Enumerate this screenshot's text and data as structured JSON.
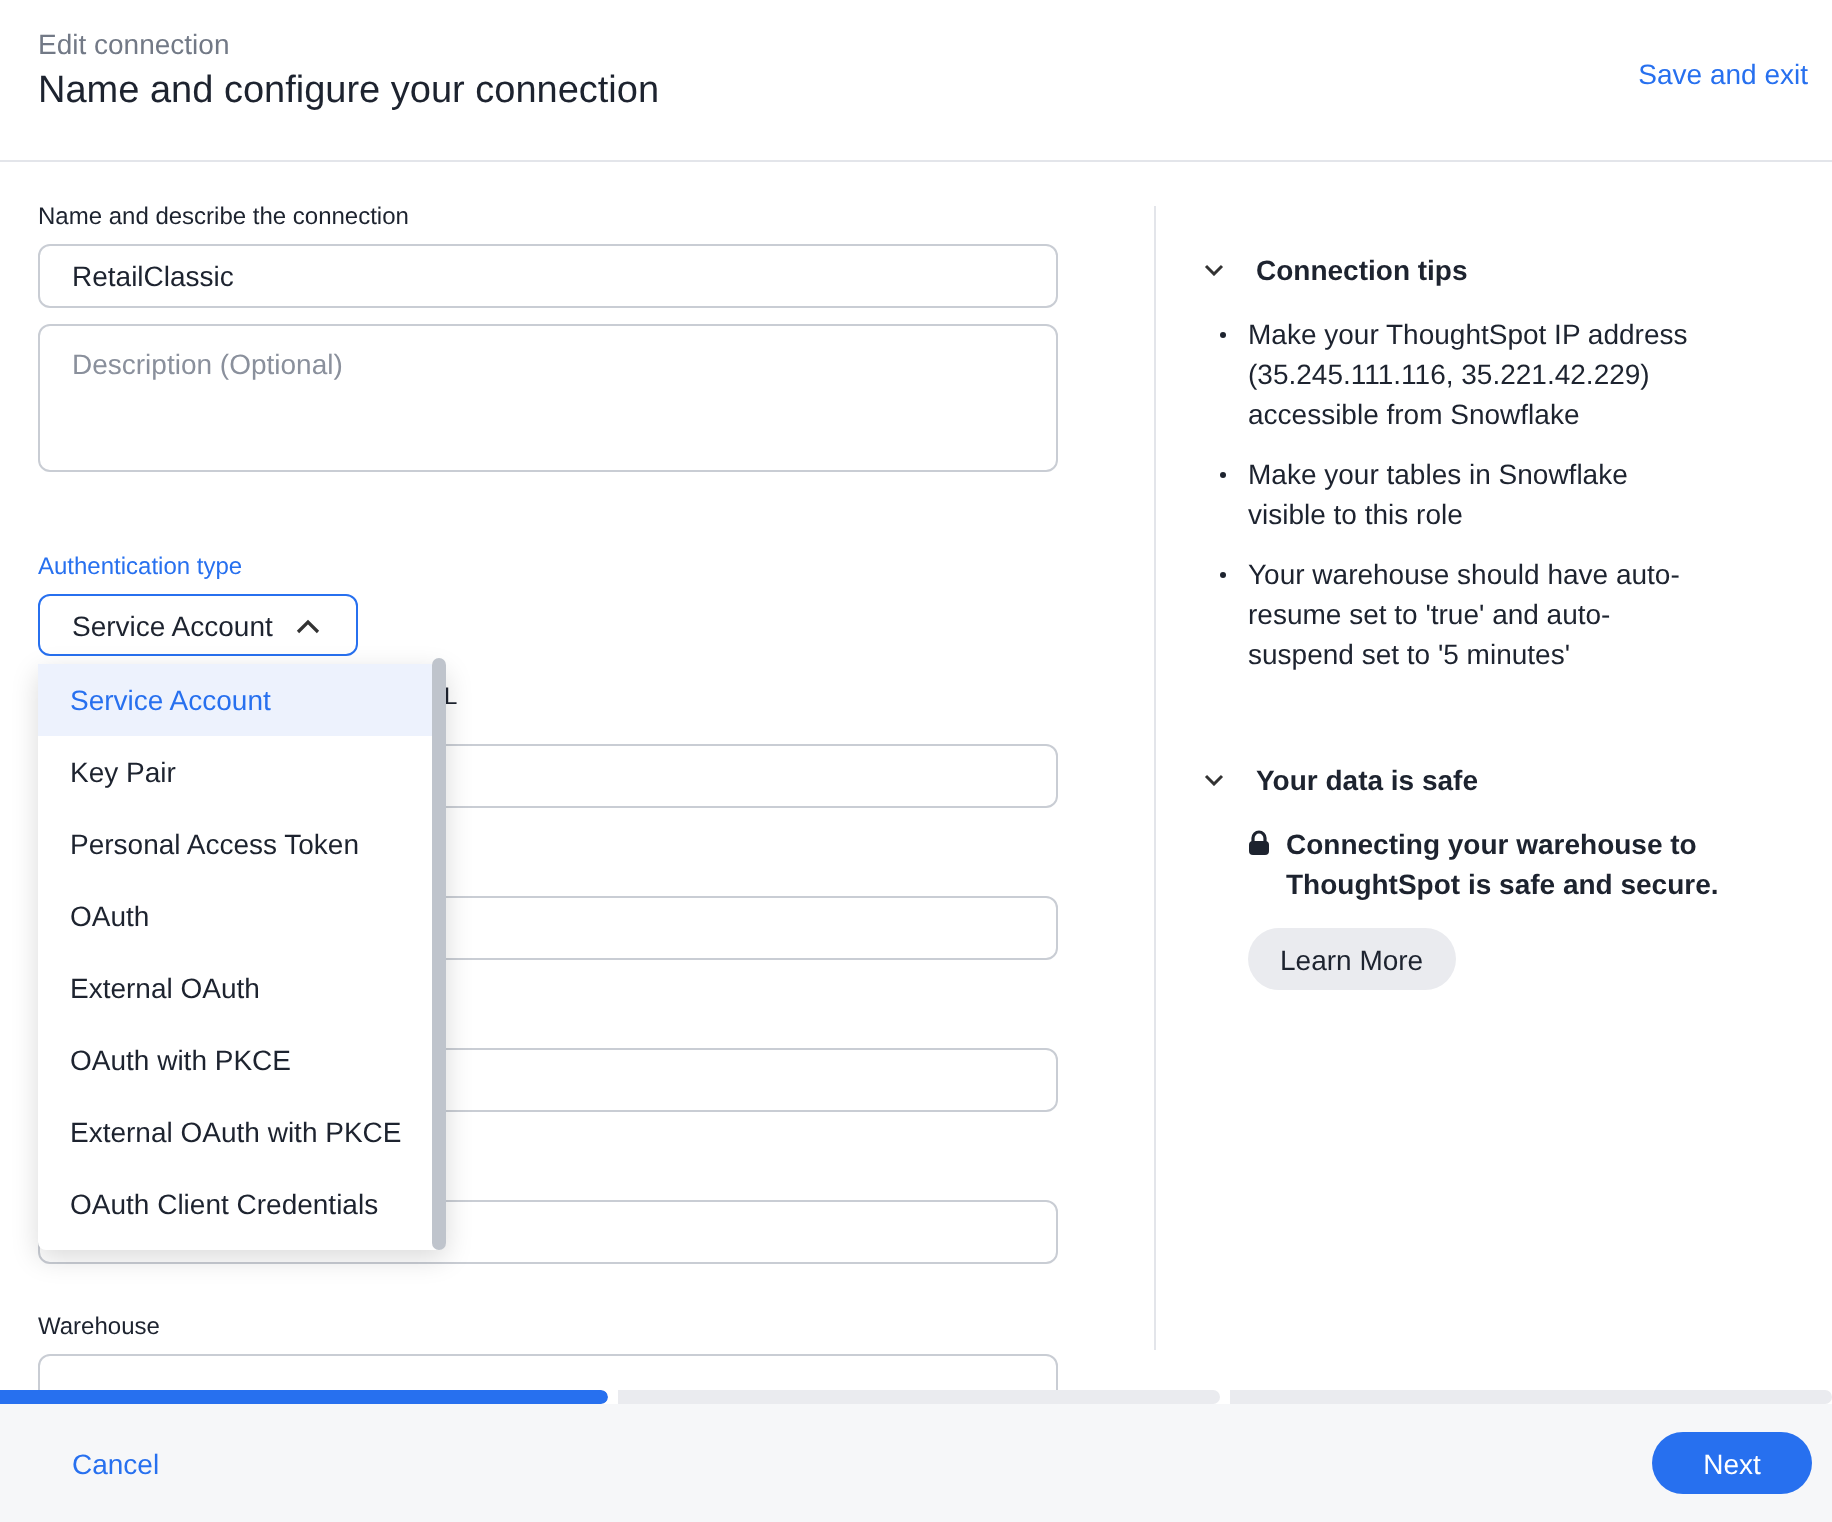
{
  "header": {
    "subtitle": "Edit connection",
    "title": "Name and configure your connection",
    "save_exit": "Save and exit"
  },
  "form": {
    "section_label": "Name and describe the connection",
    "name_value": "RetailClassic",
    "description_placeholder": "Description (Optional)",
    "auth_label": "Authentication type",
    "auth_value": "Service Account",
    "auth_expanded": true,
    "auth_options": [
      {
        "label": "Service Account",
        "selected": true
      },
      {
        "label": "Key Pair",
        "selected": false
      },
      {
        "label": "Personal Access Token",
        "selected": false
      },
      {
        "label": "OAuth",
        "selected": false
      },
      {
        "label": "External OAuth",
        "selected": false
      },
      {
        "label": "OAuth with PKCE",
        "selected": false
      },
      {
        "label": "External OAuth with PKCE",
        "selected": false
      },
      {
        "label": "OAuth Client Credentials",
        "selected": false
      }
    ],
    "obscured_field_label": "L",
    "warehouse_label": "Warehouse"
  },
  "tips": {
    "title": "Connection tips",
    "expanded": true,
    "items": [
      "Make your ThoughtSpot IP address (35.245.111.116, 35.221.42.229) accessible from Snowflake",
      "Make your tables in Snowflake visible to this role",
      "Your warehouse should have auto-resume set to 'true' and auto-suspend set to '5 minutes'"
    ]
  },
  "safe": {
    "title": "Your data is safe",
    "expanded": true,
    "text": "Connecting your warehouse to ThoughtSpot is safe and secure.",
    "button": "Learn More"
  },
  "progress": [
    {
      "level": 1
    },
    {
      "level": 0
    },
    {
      "level": 0
    }
  ],
  "footer": {
    "cancel": "Cancel",
    "next": "Next"
  }
}
